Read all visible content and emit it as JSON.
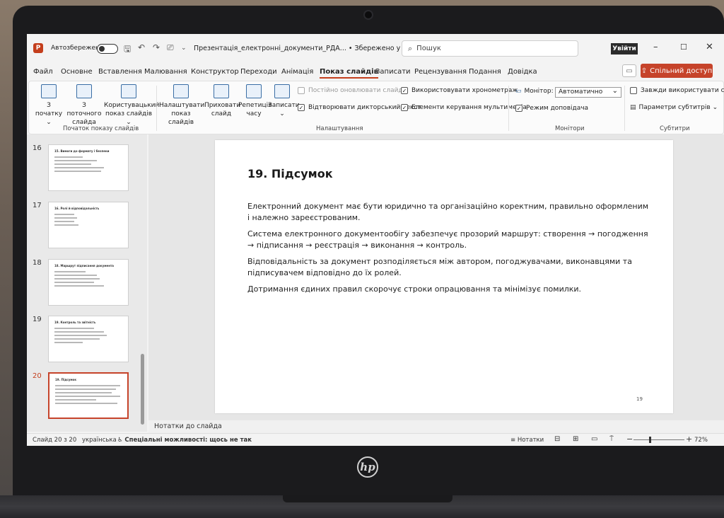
{
  "window": {
    "autosave_label": "Автозбереження",
    "doc_title": "Презентація_електронні_документи_РДА... • Збережено у цей ПК ⌄",
    "search_placeholder": "Пошук",
    "signin_label": "Увійти",
    "minimize": "–",
    "maximize": "☐",
    "close": "✕"
  },
  "menu": {
    "tabs": [
      "Файл",
      "Основне",
      "Вставлення",
      "Малювання",
      "Конструктор",
      "Переходи",
      "Анімація",
      "Показ слайдів",
      "Записати",
      "Рецензування",
      "Подання",
      "Довідка"
    ],
    "active_tab": "Показ слайдів",
    "share_label": "Спільний доступ"
  },
  "ribbon": {
    "start_group": {
      "label": "Початок показу слайдів",
      "from_start": "З початку",
      "from_current_1": "З поточного",
      "from_current_2": "слайда",
      "custom_1": "Користувацький",
      "custom_2": "показ слайдів"
    },
    "setup_group": {
      "label": "Налаштування",
      "setup_1": "Налаштувати",
      "setup_2": "показ слайдів",
      "hide_1": "Приховати",
      "hide_2": "слайд",
      "rehearse_1": "Репетиція",
      "rehearse_2": "часу",
      "record": "Записати",
      "keep_updated": "Постійно оновлювати слайди",
      "play_narrations": "Відтворювати дикторський текст",
      "use_timings": "Використовувати хронометраж",
      "media_controls": "Елементи керування мультимедіа"
    },
    "monitors_group": {
      "label": "Монітори",
      "monitor_label": "Монітор:",
      "monitor_value": "Автоматично",
      "presenter_view": "Режим доповідача"
    },
    "captions_group": {
      "label": "Субтитри",
      "always_use": "Завжди використувати су",
      "caption_settings": "Параметри субтитрів"
    }
  },
  "thumbnails": [
    {
      "num": "16",
      "title": "15. Вимоги до формату і безпеки",
      "lines": [
        60,
        80,
        70,
        90,
        85,
        65
      ]
    },
    {
      "num": "17",
      "title": "16. Ролі й відповідальність",
      "lines": [
        40,
        45,
        40,
        50
      ]
    },
    {
      "num": "18",
      "title": "18. Маршрут підписання документа",
      "lines": [
        55,
        75,
        80,
        70,
        85,
        60
      ]
    },
    {
      "num": "19",
      "title": "19. Контроль та звітність",
      "lines": [
        70,
        85,
        90,
        80,
        75,
        50
      ]
    },
    {
      "num": "20",
      "title": "19. Підсумок",
      "lines": [
        95,
        90,
        85,
        95,
        60,
        90
      ]
    }
  ],
  "active_slide_num": "20",
  "slide": {
    "title": "19. Підсумок",
    "paragraphs": [
      "Електронний документ має бути юридично та організаційно коректним, правильно оформленим і належно зареєстрованим.",
      "Система електронного документообігу забезпечує прозорий маршрут: створення → погодження → підписання → реєстрація → виконання → контроль.",
      "Відповідальність за документ розподіляється між автором, погоджувачами, виконавцями та підписувачем відповідно до їх ролей.",
      "Дотримання єдиних правил скорочує строки опрацювання та мінімізує помилки."
    ],
    "page_number": "19"
  },
  "notes_label": "Нотатки до слайда",
  "statusbar": {
    "slide_counter": "Слайд 20 з 20",
    "language": "українська",
    "accessibility": "Спеціальні можливості: щось не так",
    "notes": "Нотатки",
    "zoom_percent": "72%"
  },
  "brand": {
    "accent": "#c43e1c",
    "share_bg": "#c6432a"
  }
}
